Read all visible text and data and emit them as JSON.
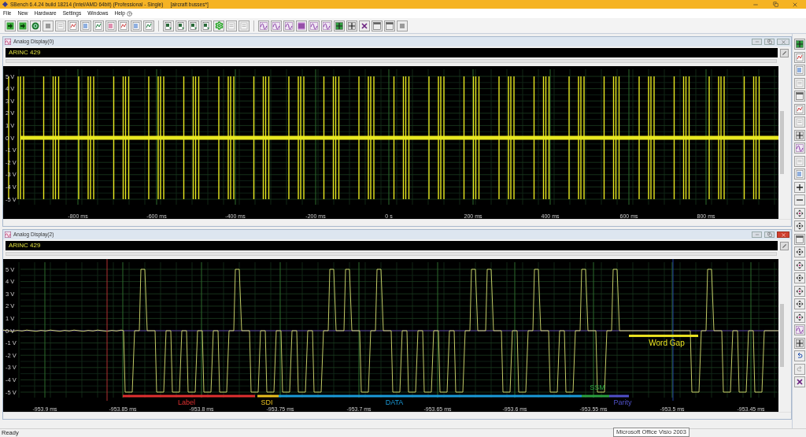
{
  "window": {
    "title": "SBench 6.4.24 build 18214 (Intel/AMD 64bit) (Professional - Single)",
    "document": "[aircraft busses*]"
  },
  "menu": [
    "File",
    "New",
    "Hardware",
    "Settings",
    "Windows",
    "Help"
  ],
  "displays": [
    {
      "title": "Analog Display(0)",
      "channel": "ARINC 429",
      "y_ticks": [
        "5 V",
        "4 V",
        "3 V",
        "2 V",
        "1 V",
        "0 V",
        "-1 V",
        "-2 V",
        "-3 V",
        "-4 V",
        "-5 V"
      ],
      "x_ticks": [
        "-800 ms",
        "-600 ms",
        "-400 ms",
        "-200 ms",
        "0 s",
        "200 ms",
        "400 ms",
        "600 ms",
        "800 ms"
      ]
    },
    {
      "title": "Analog Display(2)",
      "channel": "ARINC 429",
      "y_ticks": [
        "5 V",
        "4 V",
        "3 V",
        "2 V",
        "1 V",
        "0 V",
        "-1 V",
        "-2 V",
        "-3 V",
        "-4 V",
        "-5 V"
      ],
      "x_ticks": [
        "-953.9 ms",
        "-953.85 ms",
        "-953.8 ms",
        "-953.75 ms",
        "-953.7 ms",
        "-953.65 ms",
        "-953.6 ms",
        "-953.55 ms",
        "-953.5 ms",
        "-953.45 ms"
      ],
      "segments": [
        {
          "text": "Label",
          "color": "#e03030"
        },
        {
          "text": "SDI",
          "color": "#e8c020"
        },
        {
          "text": "DATA",
          "color": "#1a9ad8"
        },
        {
          "text": "SSM",
          "color": "#2aa040"
        },
        {
          "text": "Parity",
          "color": "#5050c8"
        }
      ],
      "word_gap": {
        "text": "Word Gap",
        "color": "#e8e020"
      }
    }
  ],
  "status_bar": {
    "text": "Ready"
  },
  "tooltip": "Microsoft Office Visio 2003"
}
